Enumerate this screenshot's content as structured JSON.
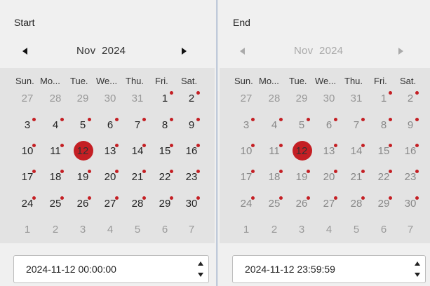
{
  "accent": "#c41f24",
  "start": {
    "title": "Start",
    "month": "Nov",
    "year": "2024",
    "prev_icon": "triangle-left-icon",
    "next_icon": "triangle-right-icon",
    "weekdays": [
      "Sun.",
      "Mo...",
      "Tue.",
      "We...",
      "Thu.",
      "Fri.",
      "Sat."
    ],
    "datetime": "2024-11-12 00:00:00"
  },
  "end": {
    "title": "End",
    "month": "Nov",
    "year": "2024",
    "prev_icon": "triangle-left-icon",
    "next_icon": "triangle-right-icon",
    "weekdays": [
      "Sun.",
      "Mo...",
      "Tue.",
      "We...",
      "Thu.",
      "Fri.",
      "Sat."
    ],
    "datetime": "2024-11-12 23:59:59"
  },
  "weeks": [
    [
      {
        "d": "27",
        "m": "prev"
      },
      {
        "d": "28",
        "m": "prev"
      },
      {
        "d": "29",
        "m": "prev"
      },
      {
        "d": "30",
        "m": "prev"
      },
      {
        "d": "31",
        "m": "prev"
      },
      {
        "d": "1",
        "m": "cur",
        "dot": true
      },
      {
        "d": "2",
        "m": "cur",
        "dot": true
      }
    ],
    [
      {
        "d": "3",
        "m": "cur",
        "dot": true
      },
      {
        "d": "4",
        "m": "cur",
        "dot": true
      },
      {
        "d": "5",
        "m": "cur",
        "dot": true
      },
      {
        "d": "6",
        "m": "cur",
        "dot": true
      },
      {
        "d": "7",
        "m": "cur",
        "dot": true
      },
      {
        "d": "8",
        "m": "cur",
        "dot": true
      },
      {
        "d": "9",
        "m": "cur",
        "dot": true
      }
    ],
    [
      {
        "d": "10",
        "m": "cur",
        "dot": true
      },
      {
        "d": "11",
        "m": "cur",
        "dot": true
      },
      {
        "d": "12",
        "m": "cur",
        "dot": true,
        "sel": true
      },
      {
        "d": "13",
        "m": "cur",
        "dot": true
      },
      {
        "d": "14",
        "m": "cur",
        "dot": true
      },
      {
        "d": "15",
        "m": "cur",
        "dot": true
      },
      {
        "d": "16",
        "m": "cur",
        "dot": true
      }
    ],
    [
      {
        "d": "17",
        "m": "cur",
        "dot": true
      },
      {
        "d": "18",
        "m": "cur",
        "dot": true
      },
      {
        "d": "19",
        "m": "cur",
        "dot": true
      },
      {
        "d": "20",
        "m": "cur",
        "dot": true
      },
      {
        "d": "21",
        "m": "cur",
        "dot": true
      },
      {
        "d": "22",
        "m": "cur",
        "dot": true
      },
      {
        "d": "23",
        "m": "cur",
        "dot": true
      }
    ],
    [
      {
        "d": "24",
        "m": "cur",
        "dot": true
      },
      {
        "d": "25",
        "m": "cur",
        "dot": true
      },
      {
        "d": "26",
        "m": "cur",
        "dot": true
      },
      {
        "d": "27",
        "m": "cur",
        "dot": true
      },
      {
        "d": "28",
        "m": "cur",
        "dot": true
      },
      {
        "d": "29",
        "m": "cur",
        "dot": true
      },
      {
        "d": "30",
        "m": "cur",
        "dot": true
      }
    ],
    [
      {
        "d": "1",
        "m": "next"
      },
      {
        "d": "2",
        "m": "next"
      },
      {
        "d": "3",
        "m": "next"
      },
      {
        "d": "4",
        "m": "next"
      },
      {
        "d": "5",
        "m": "next"
      },
      {
        "d": "6",
        "m": "next"
      },
      {
        "d": "7",
        "m": "next"
      }
    ]
  ]
}
